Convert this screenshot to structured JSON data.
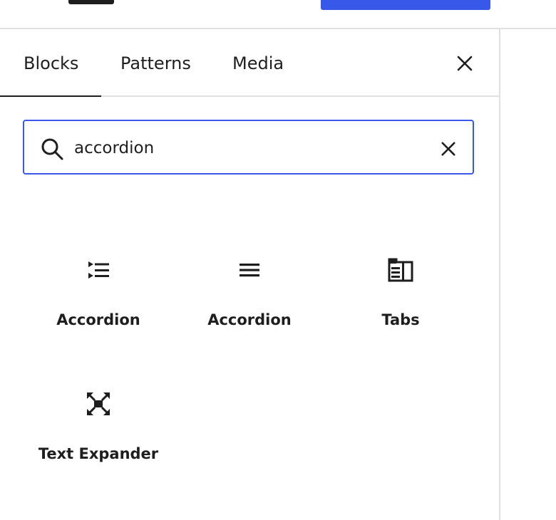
{
  "inserter": {
    "tabs": [
      {
        "label": "Blocks",
        "active": true
      },
      {
        "label": "Patterns",
        "active": false
      },
      {
        "label": "Media",
        "active": false
      }
    ],
    "close_icon": "close-icon"
  },
  "search": {
    "value": "accordion",
    "icon": "search-icon",
    "clear_icon": "close-icon"
  },
  "results": [
    {
      "label": "Accordion",
      "icon": "accordion-list-icon"
    },
    {
      "label": "Accordion",
      "icon": "menu-lines-icon"
    },
    {
      "label": "Tabs",
      "icon": "tabs-icon"
    },
    {
      "label": "Text Expander",
      "icon": "expand-arrows-icon"
    }
  ],
  "colors": {
    "accent": "#3858e9",
    "text": "#1e1e1e",
    "border": "#e0e0e0"
  }
}
